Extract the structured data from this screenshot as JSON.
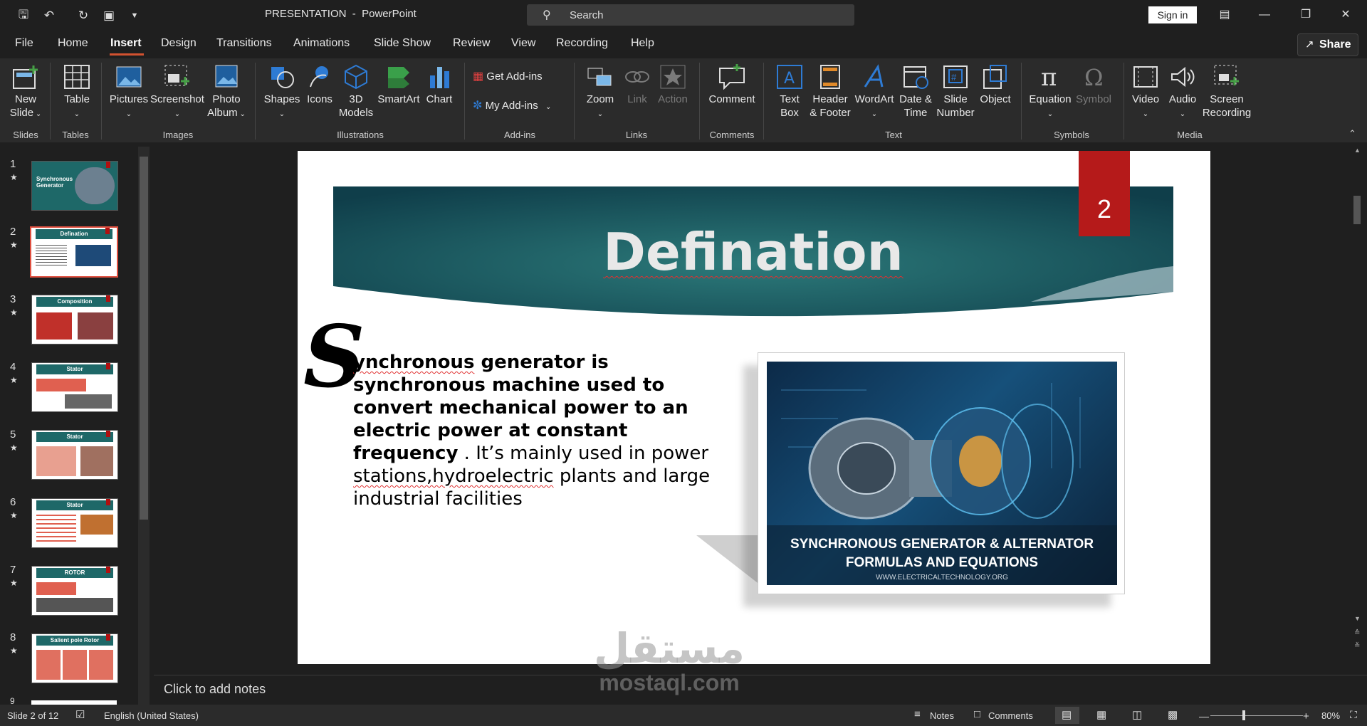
{
  "window": {
    "title": "PRESENTATION  -  PowerPoint",
    "search_placeholder": "Search",
    "signin_label": "Sign in"
  },
  "tabs": [
    "File",
    "Home",
    "Insert",
    "Design",
    "Transitions",
    "Animations",
    "Slide Show",
    "Review",
    "View",
    "Recording",
    "Help"
  ],
  "active_tab": "Insert",
  "share_label": "Share",
  "ribbon": {
    "new_slide": "New\nSlide",
    "table": "Table",
    "pictures": "Pictures",
    "screenshot": "Screenshot",
    "photo_album": "Photo\nAlbum",
    "shapes": "Shapes",
    "icons": "Icons",
    "models": "3D\nModels",
    "smartart": "SmartArt",
    "chart": "Chart",
    "get_addins": "Get Add-ins",
    "my_addins": "My Add-ins",
    "zoom": "Zoom",
    "link": "Link",
    "action": "Action",
    "comment": "Comment",
    "text_box": "Text\nBox",
    "header_footer": "Header\n& Footer",
    "wordart": "WordArt",
    "date_time": "Date &\nTime",
    "slide_number": "Slide\nNumber",
    "object": "Object",
    "equation": "Equation",
    "symbol": "Symbol",
    "video": "Video",
    "audio": "Audio",
    "screen_recording": "Screen\nRecording",
    "groups": {
      "slides": "Slides",
      "tables": "Tables",
      "images": "Images",
      "illustrations": "Illustrations",
      "addins": "Add-ins",
      "links": "Links",
      "comments": "Comments",
      "text": "Text",
      "symbols": "Symbols",
      "media": "Media"
    }
  },
  "thumbnails": [
    {
      "num": "1",
      "title": "Synchronous\nGenerator"
    },
    {
      "num": "2",
      "title": "Defination"
    },
    {
      "num": "3",
      "title": "Composition"
    },
    {
      "num": "4",
      "title": "Stator"
    },
    {
      "num": "5",
      "title": "Stator"
    },
    {
      "num": "6",
      "title": "Stator"
    },
    {
      "num": "7",
      "title": "ROTOR"
    },
    {
      "num": "8",
      "title": "Salient pole Rotor"
    }
  ],
  "slide": {
    "title": "Defination",
    "number": "2",
    "dropcap": "S",
    "body_bold_1": "ynchronous",
    "body_bold_2": " generator is synchronous machine used to convert mechanical power to an electric power at constant frequency",
    "body_reg_1": " . It’s mainly used in power ",
    "body_reg_2": "stations,hydroelectric",
    "body_reg_3": " plants and large industrial facilities",
    "image_caption_1": "SYNCHRONOUS GENERATOR & ALTERNATOR",
    "image_caption_2": "FORMULAS AND EQUATIONS",
    "image_caption_3": "WWW.ELECTRICALTECHNOLOGY.ORG"
  },
  "notes_placeholder": "Click to add notes",
  "status": {
    "slide_info": "Slide 2 of 12",
    "language": "English (United States)",
    "notes": "Notes",
    "comments": "Comments",
    "zoom": "80%"
  },
  "watermark": {
    "arabic": "مستقل",
    "latin": "mostaql.com"
  },
  "colors": {
    "accent": "#d35230",
    "banner": "#1e6868",
    "number_box": "#b51a1a"
  }
}
